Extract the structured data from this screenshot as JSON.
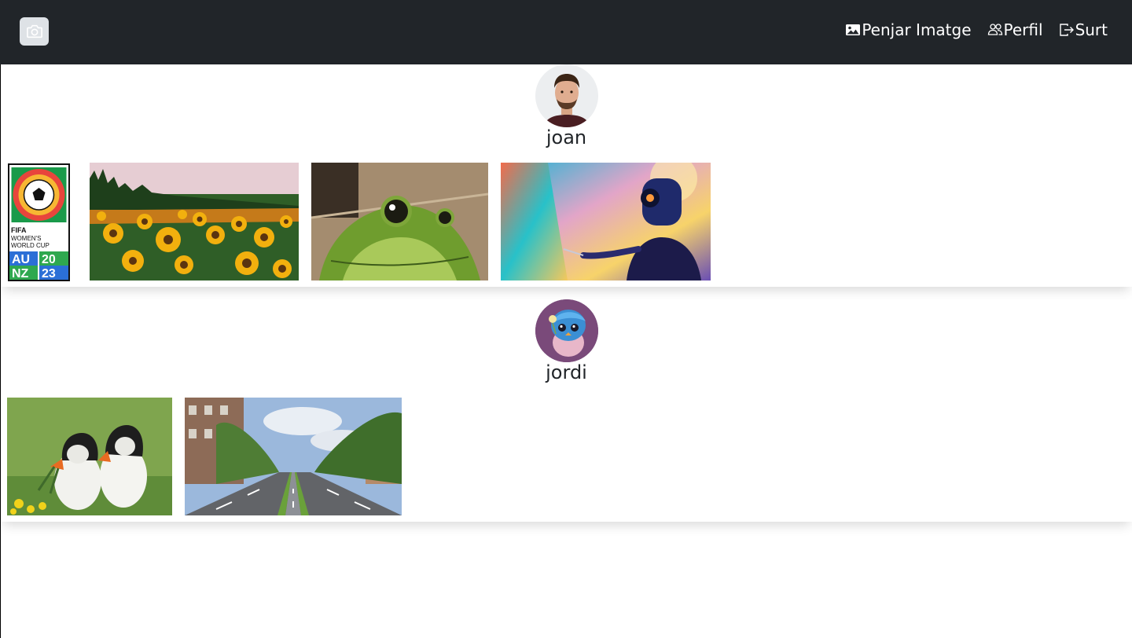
{
  "navbar": {
    "brand_icon": "camera-icon",
    "links": [
      {
        "label": "Penjar Imatge",
        "icon": "image-icon"
      },
      {
        "label": "Perfil",
        "icon": "people-icon"
      },
      {
        "label": "Surt",
        "icon": "logout-icon"
      }
    ]
  },
  "users": [
    {
      "name": "joan",
      "avatar": "man-portrait",
      "images": [
        "fifa-womens-world-cup-logo",
        "sunflower-field",
        "green-frog",
        "robot-painter"
      ],
      "logo_text": {
        "l1": "FIFA",
        "l2": "WOMEN'S",
        "l3": "WORLD CUP",
        "au": "AU",
        "nz": "NZ",
        "y1": "20",
        "y2": "23"
      }
    },
    {
      "name": "jordi",
      "avatar": "blue-bird-illustration",
      "images": [
        "puffins",
        "tree-lined-road"
      ]
    }
  ],
  "colors": {
    "navbar": "#212529",
    "brand_bg": "#dee2e6",
    "text": "#212529"
  }
}
